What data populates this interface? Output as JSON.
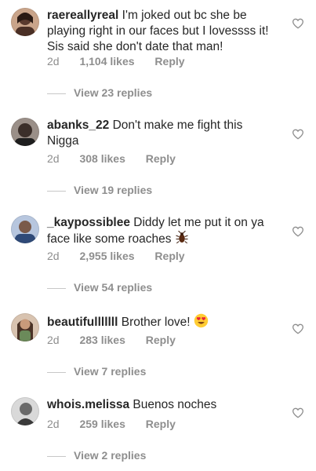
{
  "comments": [
    {
      "username": "raereallyreal",
      "text": "I'm joked out bc she be playing right in our faces but I lovessss it! Sis said she don't date that man!",
      "age": "2d",
      "likes": "1,104 likes",
      "reply": "Reply",
      "view_replies": "View 23 replies",
      "avatar_color": "#5a3a2e"
    },
    {
      "username": "abanks_22",
      "text": "Don't make me fight this Nigga",
      "age": "2d",
      "likes": "308 likes",
      "reply": "Reply",
      "view_replies": "View 19 replies",
      "avatar_color": "#3b2f2a"
    },
    {
      "username": "_kaypossiblee",
      "text": "Diddy let me put it on ya face like some roaches",
      "emoji": "cockroach",
      "age": "2d",
      "likes": "2,955 likes",
      "reply": "Reply",
      "view_replies": "View 54 replies",
      "avatar_color": "#2f4a78"
    },
    {
      "username": "beautifulllllll",
      "text": "Brother love!",
      "emoji": "heart-eyes",
      "age": "2d",
      "likes": "283 likes",
      "reply": "Reply",
      "view_replies": "View 7 replies",
      "avatar_color": "#6b8a5a"
    },
    {
      "username": "whois.melissa",
      "text": "Buenos noches",
      "age": "2d",
      "likes": "259 likes",
      "reply": "Reply",
      "view_replies": "View 2 replies",
      "avatar_color": "#6a6a6a"
    }
  ]
}
